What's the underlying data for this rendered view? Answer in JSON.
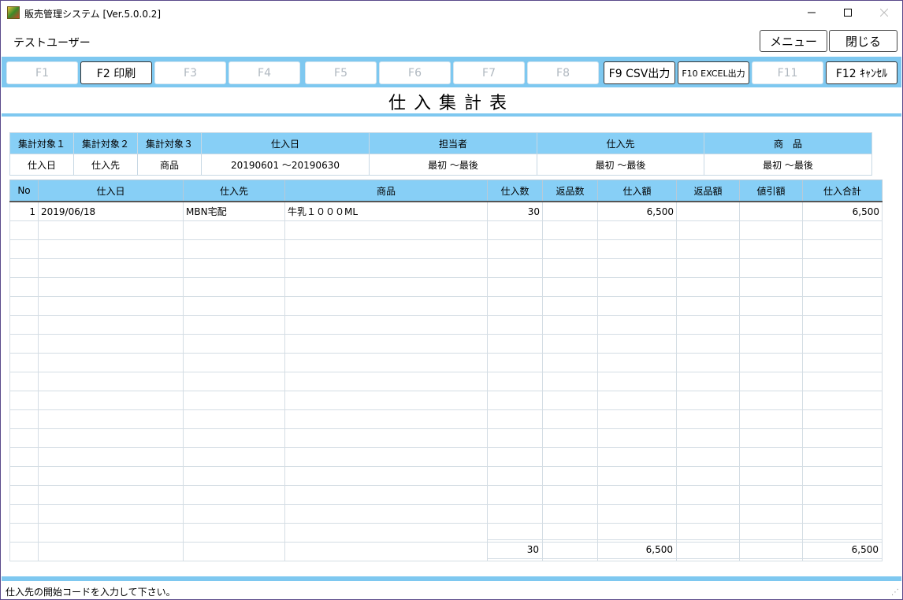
{
  "window": {
    "title": "販売管理システム [Ver.5.0.0.2]",
    "minimize_icon": "minimize-icon",
    "maximize_icon": "maximize-icon",
    "close_icon": "close-icon"
  },
  "header": {
    "user": "テストユーザー",
    "menu_label": "メニュー",
    "close_label": "閉じる"
  },
  "fkeys": [
    {
      "label": "F1",
      "enabled": false
    },
    {
      "label": "F2 印刷",
      "enabled": true
    },
    {
      "label": "F3",
      "enabled": false
    },
    {
      "label": "F4",
      "enabled": false
    },
    {
      "label": "F5",
      "enabled": false
    },
    {
      "label": "F6",
      "enabled": false
    },
    {
      "label": "F7",
      "enabled": false
    },
    {
      "label": "F8",
      "enabled": false
    },
    {
      "label": "F9 CSV出力",
      "enabled": true
    },
    {
      "label": "F10 EXCEL出力",
      "enabled": true
    },
    {
      "label": "F11",
      "enabled": false
    },
    {
      "label": "F12 ｷｬﾝｾﾙ",
      "enabled": true
    }
  ],
  "page_title": "仕入集計表",
  "conditions": {
    "headers": [
      "集計対象１",
      "集計対象２",
      "集計対象３",
      "仕入日",
      "担当者",
      "仕入先",
      "商　品"
    ],
    "values": [
      "仕入日",
      "仕入先",
      "商品",
      "20190601 ～20190630",
      "最初 ～最後",
      "最初 ～最後",
      "最初 ～最後"
    ]
  },
  "grid": {
    "columns": [
      "No",
      "仕入日",
      "仕入先",
      "商品",
      "仕入数",
      "返品数",
      "仕入額",
      "返品額",
      "値引額",
      "仕入合計"
    ],
    "rows": [
      [
        "1",
        "2019/06/18",
        "MBN宅配",
        "牛乳１０００ML",
        "30",
        "",
        "6,500",
        "",
        "",
        "6,500"
      ]
    ],
    "empty_rows": 18,
    "totals": {
      "仕入数": "30",
      "返品数": "",
      "仕入額": "6,500",
      "返品額": "",
      "値引額": "",
      "仕入合計": "6,500"
    }
  },
  "status_bar": {
    "message": "仕入先の開始コードを入力して下さい。"
  },
  "colors": {
    "accent": "#7ec8f0",
    "header_cell": "#87cff6"
  }
}
